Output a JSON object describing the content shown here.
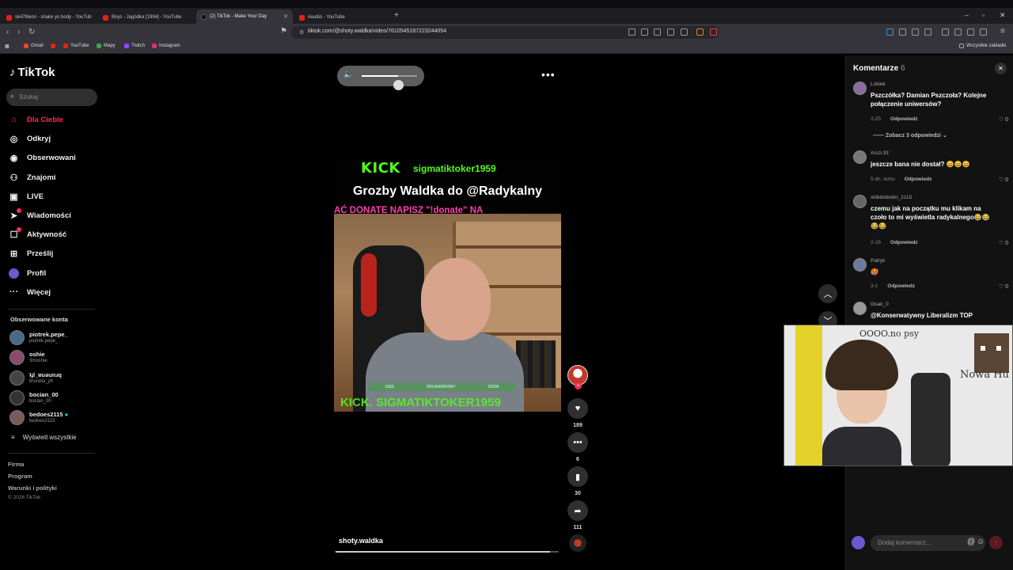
{
  "browser": {
    "tabs": [
      {
        "title": "sk47liteon - shake yo body - YouTub",
        "icon": "youtube"
      },
      {
        "title": "Boys - Jagódka [1994] - YouTube",
        "icon": "youtube"
      },
      {
        "title": "(2) TikTok - Make Your Day",
        "icon": "tiktok"
      },
      {
        "title": "#audio - YouTube",
        "icon": "youtube"
      }
    ],
    "url": "tiktok.com/@shoty.waldka/video/7610545187223244054",
    "bookmarks": [
      "Gmail",
      "YouTube",
      "Mapy",
      "Twitch",
      "Instagram"
    ],
    "all_bookmarks": "Wszystkie zakładki"
  },
  "sidebar": {
    "logo": "TikTok",
    "search_placeholder": "Szukaj",
    "nav": [
      {
        "label": "Dla Ciebie",
        "icon": "home-icon",
        "active": true
      },
      {
        "label": "Odkryj",
        "icon": "compass-icon"
      },
      {
        "label": "Obserwowani",
        "icon": "following-icon"
      },
      {
        "label": "Znajomi",
        "icon": "friends-icon"
      },
      {
        "label": "LIVE",
        "icon": "live-icon"
      },
      {
        "label": "Wiadomości",
        "icon": "messages-icon"
      },
      {
        "label": "Aktywność",
        "icon": "activity-icon"
      },
      {
        "label": "Prześlij",
        "icon": "upload-icon"
      },
      {
        "label": "Profil",
        "icon": "profile-icon"
      },
      {
        "label": "Więcej",
        "icon": "more-icon"
      }
    ],
    "following_title": "Obserwowane konta",
    "accounts": [
      {
        "name": "piotrek.pepe_",
        "handle": "piotrek.pepe_"
      },
      {
        "name": "oshie",
        "handle": "3moshie"
      },
      {
        "name": "ʇɟl_ɐuǝunɹq",
        "handle": "bruneta_yfl"
      },
      {
        "name": "bocian_00",
        "handle": "bocian_00"
      },
      {
        "name": "bedoes2115",
        "handle": "bedoes2115"
      }
    ],
    "show_all": "Wyświetl wszystkie",
    "footer": [
      "Firma",
      "Program",
      "Warunki i polityki"
    ],
    "copyright": "© 2026 TikTok"
  },
  "video": {
    "kick": "KICK",
    "kick_user": "sigmatiktoker1959",
    "title": "Grozby Waldka do @Radykalny",
    "donate_banner": "AĆ DONATE NAPISZ \"!donate\" NA",
    "bottom_banner": "KICK. SIGMATIKTOKER1959",
    "overlay_bar_left": "1569",
    "overlay_bar_mid": "DRUKARNOWY",
    "overlay_bar_right": "20000",
    "author": "shoty.waldka",
    "volume_level": 0.66,
    "progress": 0.96,
    "likes": "189",
    "comments": "6",
    "saves": "30",
    "shares": "111"
  },
  "comments": {
    "title": "Komentarze",
    "count": "6",
    "reply_label": "Odpowiedz",
    "see_replies": "Zobacz 3 odpowiedzi",
    "items": [
      {
        "user": "Lóklek",
        "text": "Pszczółka? Damian Pszczoła? Kolejne połączenie uniwersów?",
        "date": "2-25",
        "likes": "0"
      },
      {
        "user": "Arczi.91'",
        "text": "jeszcze bana nie dostał? 😄😄😄",
        "date": "5 dn. temu",
        "likes": "0"
      },
      {
        "user": "skibidobobo_2115",
        "text": "czemu jak na początku mu klikam na czoło to mi wyświetla radykalnego😂😂😂😂",
        "date": "2-26",
        "likes": "0"
      },
      {
        "user": "Patryk",
        "text": "🥵",
        "date": "3-1",
        "likes": "0"
      },
      {
        "user": "t3sak_0",
        "text": "@Konserwatywny Liberalizm TOP",
        "date": "",
        "likes": ""
      }
    ],
    "add_placeholder": "Dodaj komentarz..."
  },
  "webcam": {
    "scribble_1": "OOOO.no psy",
    "scribble_2": "Nowa Hu"
  }
}
